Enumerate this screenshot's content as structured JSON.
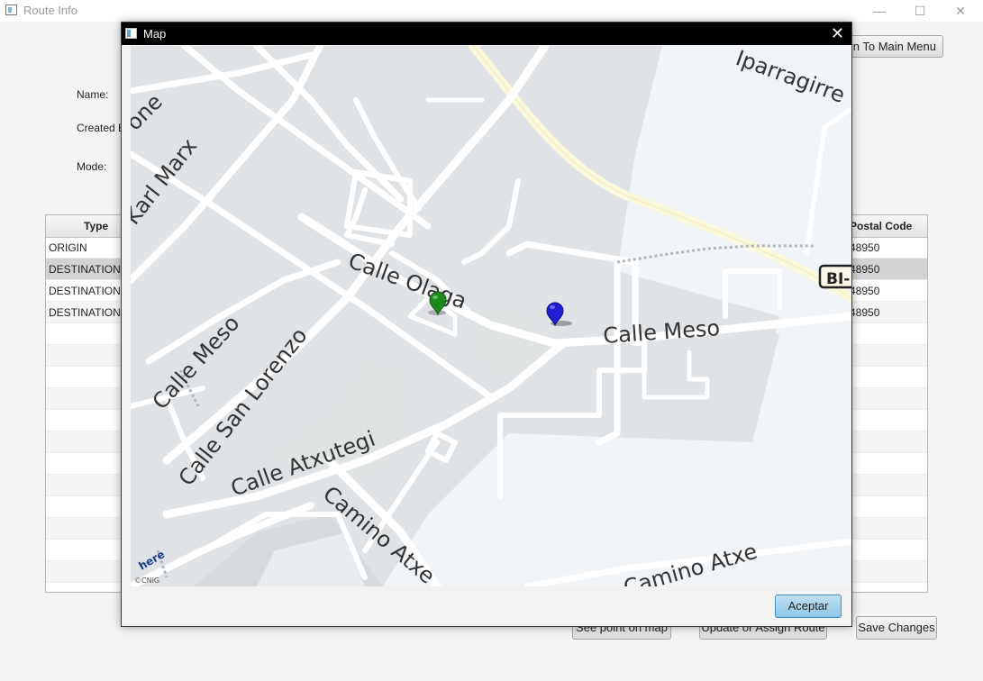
{
  "window": {
    "title": "Route Info",
    "minimize": "—",
    "maximize": "☐",
    "close": "✕"
  },
  "buttons": {
    "return_main": "Return To Main Menu",
    "see_point": "See point on map",
    "update_assign": "Update or Assign Route",
    "save_changes": "Save Changes"
  },
  "form": {
    "name_label": "Name:",
    "created_label": "Created By:",
    "mode_label": "Mode:"
  },
  "table": {
    "columns": {
      "type": "Type",
      "postal": "Postal Code"
    },
    "rows": [
      {
        "type": "ORIGIN",
        "postal": "48950"
      },
      {
        "type": "DESTINATION",
        "postal": "48950"
      },
      {
        "type": "DESTINATION",
        "postal": "48950"
      },
      {
        "type": "DESTINATION",
        "postal": "48950"
      }
    ]
  },
  "modal": {
    "title": "Map",
    "close": "✕",
    "accept": "Aceptar",
    "map": {
      "streets": [
        "Calle Olaga",
        "Calle Meso",
        "Calle Meso",
        "Calle San Lorenzo",
        "Calle Atxutegi",
        "Camino Atxe",
        "Camino Atxe",
        "Karl Marx",
        "Iparragirre",
        "one"
      ],
      "road_badge": "BI-",
      "logo": "here",
      "copyright": "©CNIG"
    },
    "markers": [
      {
        "name": "green-pin",
        "color": "#1e8a1e"
      },
      {
        "name": "blue-pin",
        "color": "#1f1fd6"
      }
    ]
  }
}
